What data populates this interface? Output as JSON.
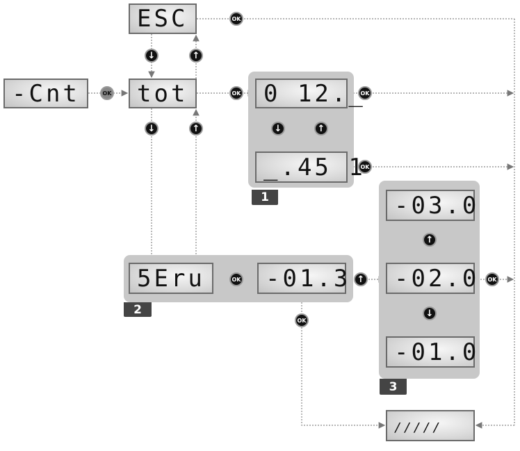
{
  "displays": {
    "esc": "ESC",
    "cnt": "-Cnt",
    "tot": "tot",
    "high": "0 12._",
    "low": "_.45 1",
    "serv": "5Eru",
    "serv_value": "-01.3",
    "opt_up": "-03.0",
    "opt_mid": "-02.0",
    "opt_down": "-01.0",
    "confirm": "/////"
  },
  "groups": {
    "g1": "1",
    "g2": "2",
    "g3": "3"
  },
  "buttons": {
    "ok": "OK",
    "up": "↑",
    "down": "↓"
  },
  "colors": {
    "group_bg": "#c8c8c8",
    "tag_bg": "#444444",
    "line": "#888888",
    "button": "#111111"
  }
}
